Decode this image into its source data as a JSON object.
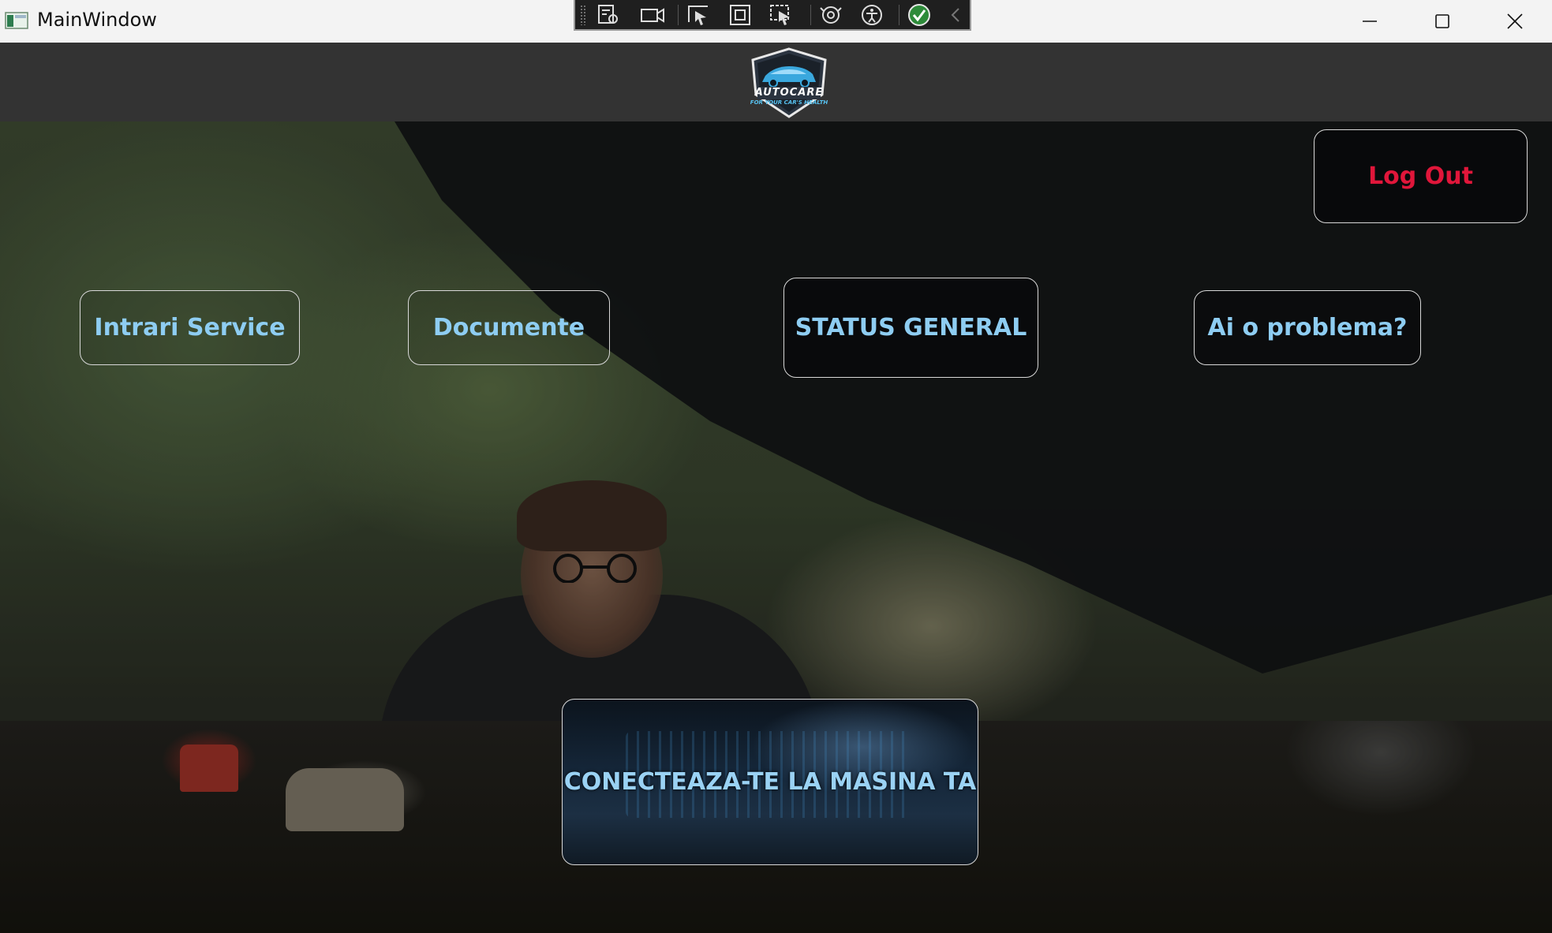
{
  "window": {
    "title": "MainWindow"
  },
  "header": {
    "logo": {
      "name": "AUTOCARE",
      "tagline": "FOR YOUR CAR'S HEALTH"
    }
  },
  "buttons": {
    "logout": "Log Out",
    "intrari_service": "Intrari Service",
    "documente": "Documente",
    "status_general": "STATUS GENERAL",
    "ai_o_problema": "Ai o problema?",
    "conecteaza": "CONECTEAZA-TE LA MASINA TA"
  },
  "colors": {
    "accent": "#8ecdf2",
    "logout": "#e0163a",
    "header_bg": "#333333"
  },
  "icons": {
    "devbar": [
      "live-visual-tree-icon",
      "video-icon",
      "select-element-icon",
      "display-layout-icon",
      "track-focus-icon",
      "binding-failures-icon",
      "accessibility-icon",
      "hot-reload-ok-icon",
      "collapse-icon"
    ]
  }
}
